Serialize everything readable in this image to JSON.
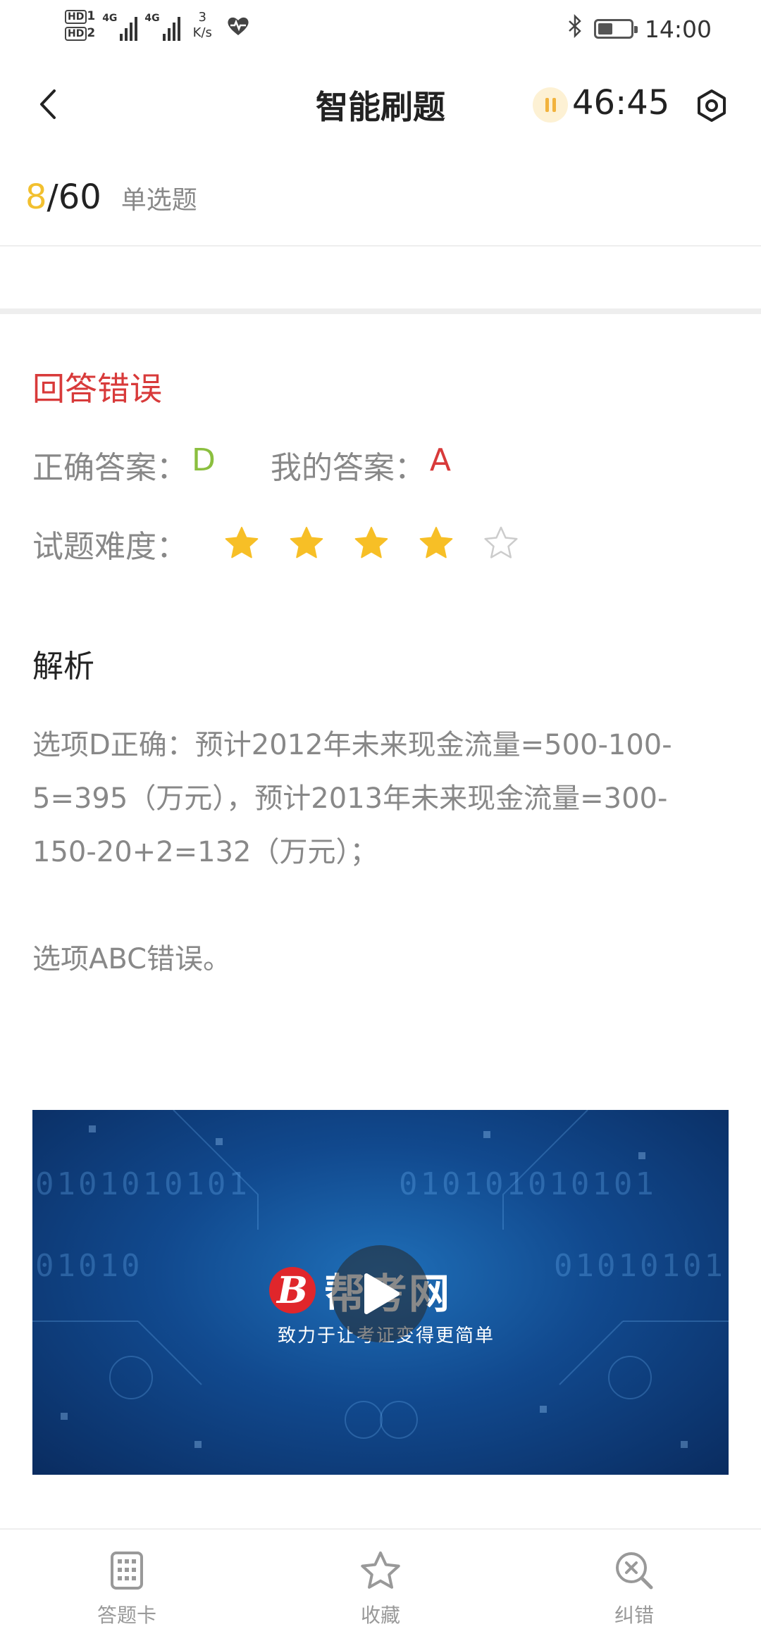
{
  "status_bar": {
    "hd1": "HD",
    "hd1_sub": "1",
    "hd2": "HD",
    "hd2_sub": "2",
    "net1": "4G",
    "net2": "4G",
    "speed_value": "3",
    "speed_unit": "K/s",
    "time": "14:00",
    "battery_level": 0.45,
    "icons": [
      "signal-icon",
      "heart-rate-icon",
      "bluetooth-icon",
      "battery-icon"
    ]
  },
  "header": {
    "title": "智能刷题",
    "timer": "46:45",
    "icons": [
      "back-icon",
      "pause-icon",
      "settings-icon"
    ]
  },
  "progress": {
    "current": "8",
    "total": "/60",
    "question_type": "单选题"
  },
  "result": {
    "title": "回答错误",
    "correct_label": "正确答案：",
    "correct_value": "D",
    "mine_label": "我的答案：",
    "mine_value": "A",
    "difficulty_label": "试题难度：",
    "difficulty_stars": 4,
    "difficulty_max": 5
  },
  "analysis": {
    "title": "解析",
    "paragraph1": "选项D正确：预计2012年未来现金流量=500-100-5=395（万元），预计2013年未来现金流量=300-150-20+2=132（万元）；",
    "paragraph2": "选项ABC错误。"
  },
  "video": {
    "logo_mark": "B",
    "logo_text": "帮考网",
    "slogan": "致力于让考证变得更简单",
    "bits_line1": "0101010101",
    "bits_line2": "010101010101",
    "bits_line3": "01010",
    "bits_line4": "01010101"
  },
  "bottom_bar": {
    "tabs": [
      {
        "label": "答题卡",
        "icon": "answer-card-icon"
      },
      {
        "label": "收藏",
        "icon": "star-outline-icon"
      },
      {
        "label": "纠错",
        "icon": "error-report-icon"
      }
    ]
  },
  "colors": {
    "accent_yellow": "#f2c02f",
    "error_red": "#d83a3a",
    "correct_green": "#8bbf3f",
    "star_gold": "#f7bf26"
  }
}
